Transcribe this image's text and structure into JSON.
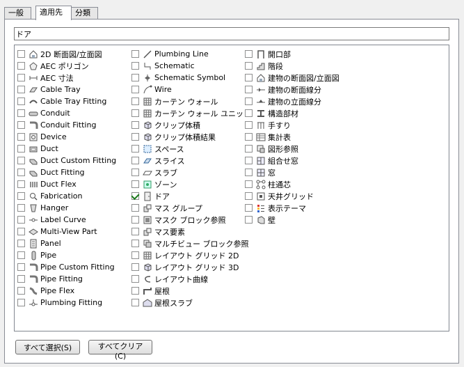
{
  "tabs": [
    {
      "label": "一般"
    },
    {
      "label": "適用先"
    },
    {
      "label": "分類"
    }
  ],
  "search": {
    "value": "ドア"
  },
  "columns": [
    [
      {
        "label": "2D 断面図/立面図",
        "icon": "house"
      },
      {
        "label": "AEC ポリゴン",
        "icon": "pentagon"
      },
      {
        "label": "AEC 寸法",
        "icon": "dimension"
      },
      {
        "label": "Cable Tray",
        "icon": "tray"
      },
      {
        "label": "Cable Tray Fitting",
        "icon": "tray-fitting"
      },
      {
        "label": "Conduit",
        "icon": "pipe"
      },
      {
        "label": "Conduit Fitting",
        "icon": "elbow"
      },
      {
        "label": "Device",
        "icon": "device"
      },
      {
        "label": "Duct",
        "icon": "duct"
      },
      {
        "label": "Duct Custom Fitting",
        "icon": "duct-fitting"
      },
      {
        "label": "Duct Fitting",
        "icon": "duct-fitting"
      },
      {
        "label": "Duct Flex",
        "icon": "flex"
      },
      {
        "label": "Fabrication",
        "icon": "magnifier"
      },
      {
        "label": "Hanger",
        "icon": "hanger"
      },
      {
        "label": "Label Curve",
        "icon": "label-curve"
      },
      {
        "label": "Multi-View Part",
        "icon": "diamond"
      },
      {
        "label": "Panel",
        "icon": "panel"
      },
      {
        "label": "Pipe",
        "icon": "pipe-v"
      },
      {
        "label": "Pipe Custom Fitting",
        "icon": "elbow"
      },
      {
        "label": "Pipe Fitting",
        "icon": "elbow"
      },
      {
        "label": "Pipe Flex",
        "icon": "flex-pipe"
      },
      {
        "label": "Plumbing Fitting",
        "icon": "plumbing"
      }
    ],
    [
      {
        "label": "Plumbing Line",
        "icon": "line"
      },
      {
        "label": "Schematic",
        "icon": "schematic"
      },
      {
        "label": "Schematic Symbol",
        "icon": "symbol"
      },
      {
        "label": "Wire",
        "icon": "wire"
      },
      {
        "label": "カーテン ウォール",
        "icon": "grid"
      },
      {
        "label": "カーテン ウォール ユニット",
        "icon": "grid"
      },
      {
        "label": "クリップ体積",
        "icon": "cube"
      },
      {
        "label": "クリップ体積結果",
        "icon": "cube"
      },
      {
        "label": "スペース",
        "icon": "space"
      },
      {
        "label": "スライス",
        "icon": "slice"
      },
      {
        "label": "スラブ",
        "icon": "slab"
      },
      {
        "label": "ゾーン",
        "icon": "zone"
      },
      {
        "label": "ドア",
        "icon": "door",
        "checked": true
      },
      {
        "label": "マス グループ",
        "icon": "mass"
      },
      {
        "label": "マスク ブロック参照",
        "icon": "mask"
      },
      {
        "label": "マス要素",
        "icon": "mass"
      },
      {
        "label": "マルチビュー ブロック参照",
        "icon": "block"
      },
      {
        "label": "レイアウト グリッド 2D",
        "icon": "grid"
      },
      {
        "label": "レイアウト グリッド 3D",
        "icon": "cube"
      },
      {
        "label": "レイアウト曲線",
        "icon": "curve"
      },
      {
        "label": "屋根",
        "icon": "roof"
      },
      {
        "label": "屋根スラブ",
        "icon": "roof-slab"
      }
    ],
    [
      {
        "label": "開口部",
        "icon": "opening"
      },
      {
        "label": "階段",
        "icon": "stair"
      },
      {
        "label": "建物の断面図/立面図",
        "icon": "house"
      },
      {
        "label": "建物の断面線分",
        "icon": "section"
      },
      {
        "label": "建物の立面線分",
        "icon": "elevation"
      },
      {
        "label": "構造部材",
        "icon": "member"
      },
      {
        "label": "手すり",
        "icon": "railing"
      },
      {
        "label": "集計表",
        "icon": "table"
      },
      {
        "label": "図形参照",
        "icon": "shape"
      },
      {
        "label": "組合せ窓",
        "icon": "window-assembly"
      },
      {
        "label": "窓",
        "icon": "window"
      },
      {
        "label": "柱通芯",
        "icon": "column-grid"
      },
      {
        "label": "天井グリッド",
        "icon": "ceiling"
      },
      {
        "label": "表示テーマ",
        "icon": "theme"
      },
      {
        "label": "壁",
        "icon": "wall"
      }
    ]
  ],
  "buttons": {
    "select_all": "すべて選択(S)",
    "clear_all": "すべてクリア(C)"
  }
}
